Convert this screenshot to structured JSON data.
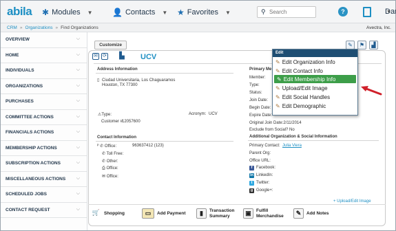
{
  "app": {
    "logo": "abila"
  },
  "nav": {
    "modules": "Modules",
    "contacts": "Contacts",
    "favorites": "Favorites"
  },
  "search": {
    "placeholder": "Search"
  },
  "user": {
    "name": "Dan"
  },
  "breadcrumb": {
    "items": [
      "CRM",
      "Organizations",
      "Find Organizations"
    ],
    "right": "Avectra, Inc."
  },
  "sidebar": {
    "items": [
      {
        "label": "OVERVIEW"
      },
      {
        "label": "HOME"
      },
      {
        "label": "INDIVIDUALS"
      },
      {
        "label": "ORGANIZATIONS"
      },
      {
        "label": "PURCHASES"
      },
      {
        "label": "COMMITTEE ACTIONS"
      },
      {
        "label": "FINANCIALS ACTIONS"
      },
      {
        "label": "MEMBERSHIP ACTIONS"
      },
      {
        "label": "SUBSCRIPTION ACTIONS"
      },
      {
        "label": "MISCELLANEOUS ACTIONS"
      },
      {
        "label": "SCHEDULED JOBS"
      },
      {
        "label": "CONTACT REQUEST"
      }
    ]
  },
  "main": {
    "customize_label": "Customize",
    "org_name": "UCV",
    "address": {
      "title": "Address Information",
      "line1": "Ciudad Universitaria, Los Chaguaramos",
      "line2": "Houston, TX 77300"
    },
    "details": {
      "type_label": "Type:",
      "acronym_label": "Acronym:",
      "acronym_value": "UCV",
      "customer_label": "Customer #:",
      "customer_value": "12057600"
    },
    "contact": {
      "title": "Contact Information",
      "office_label": "Office:",
      "office_value": "963637412 (123)",
      "tollfree_label": "Toll Free:",
      "other_label": "Other:",
      "office2_label": "Office:",
      "office3_label": "Office:"
    },
    "primary": {
      "title": "Primary Me",
      "member": "Member:",
      "type": "Type:",
      "status": "Status:",
      "join": "Join Date:",
      "begin": "Begin Date:",
      "expire": "Expire Date:",
      "original_join": "Original Join Date:2/11/2014",
      "exclude": "Exclude from Social? No"
    },
    "additional": {
      "title": "Additional Organization & Social Information",
      "primary_contact_label": "Primary Contact:",
      "primary_contact_value": "Julia Viera",
      "parent_org": "Parent Org:",
      "office_url": "Office URL:",
      "facebook": "Facebook:",
      "linkedin": "LinkedIn:",
      "twitter": "Twitter:",
      "google": "Google+:",
      "upload_link": "Upload/Edit Image"
    }
  },
  "actions": [
    {
      "label": "Shopping"
    },
    {
      "label": "Add Payment"
    },
    {
      "label": "Transaction Summary",
      "line1": "Transaction",
      "line2": "Summary"
    },
    {
      "label": "Fulfill Merchandise",
      "line1": "Fulfill",
      "line2": "Merchandise"
    },
    {
      "label": "Add Notes"
    }
  ],
  "menu": {
    "header": "Edit",
    "items": [
      "Edit Organization Info",
      "Edit Contact Info",
      "Edit Membership Info",
      "Upload/Edit Image",
      "Edit Social Handles",
      "Edit Demographic"
    ]
  },
  "colors": {
    "accent": "#1d8fc3",
    "menu_header": "#1e4e73",
    "highlight": "#3d9e49",
    "arrow": "#d0202a"
  }
}
